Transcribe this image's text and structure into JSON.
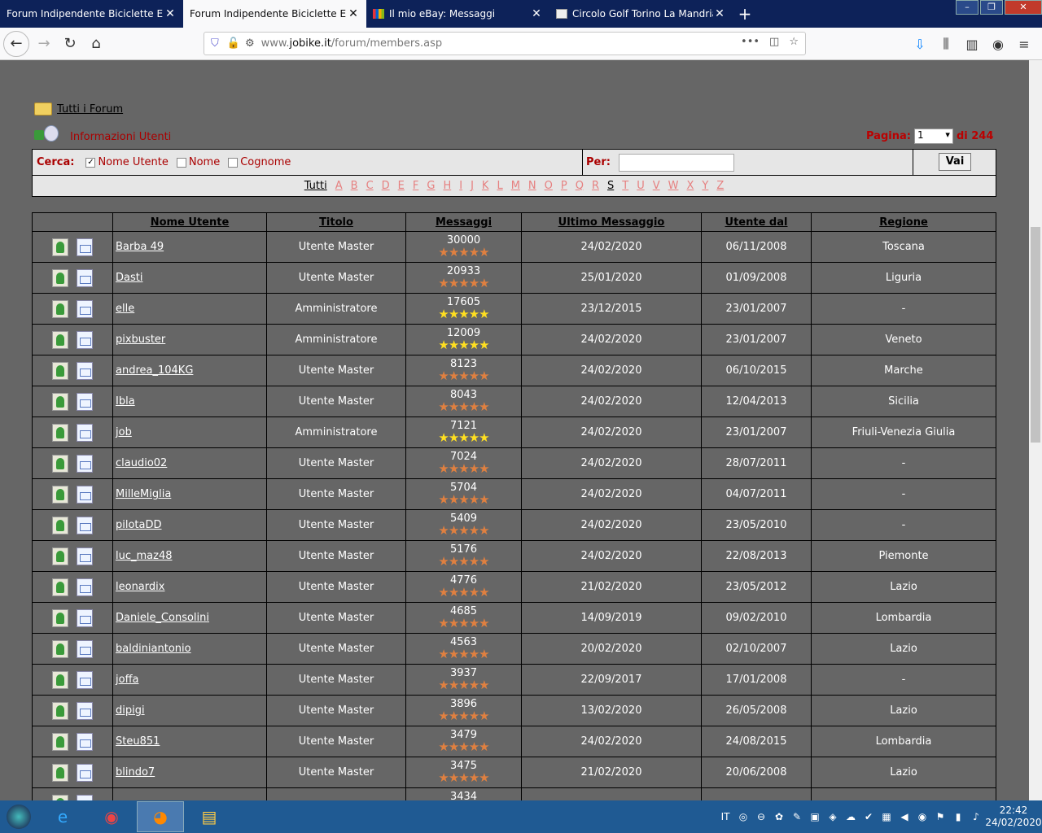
{
  "tabs": [
    {
      "label": "Forum Indipendente Biciclette Elett",
      "active": false
    },
    {
      "label": "Forum Indipendente Biciclette Elett",
      "active": true
    },
    {
      "label": "Il mio eBay: Messaggi",
      "active": false
    },
    {
      "label": "Circolo Golf Torino La Mandria",
      "active": false
    }
  ],
  "url": {
    "prefix": "www.",
    "domain": "jobike.it",
    "path": "/forum/members.asp"
  },
  "breadcrumb": {
    "all_forums": "Tutti i Forum",
    "members_info": "Informazioni Utenti"
  },
  "pagination": {
    "label": "Pagina:",
    "current": "1",
    "total": "di 244"
  },
  "search": {
    "cerca": "Cerca:",
    "opt_username": "Nome Utente",
    "opt_name": "Nome",
    "opt_surname": "Cognome",
    "per": "Per:",
    "button": "Vai"
  },
  "letters": [
    "Tutti",
    "A",
    "B",
    "C",
    "D",
    "E",
    "F",
    "G",
    "H",
    "I",
    "J",
    "K",
    "L",
    "M",
    "N",
    "O",
    "P",
    "Q",
    "R",
    "S",
    "T",
    "U",
    "V",
    "W",
    "X",
    "Y",
    "Z"
  ],
  "current_letter": "S",
  "columns": [
    "Nome Utente",
    "Titolo",
    "Messaggi",
    "Ultimo Messaggio",
    "Utente dal",
    "Regione"
  ],
  "members": [
    {
      "name": "Barba 49",
      "title": "Utente Master",
      "posts": "30000",
      "star": "o",
      "last": "24/02/2020",
      "since": "06/11/2008",
      "region": "Toscana"
    },
    {
      "name": "Dasti",
      "title": "Utente Master",
      "posts": "20933",
      "star": "o",
      "last": "25/01/2020",
      "since": "01/09/2008",
      "region": "Liguria"
    },
    {
      "name": "elle",
      "title": "Amministratore",
      "posts": "17605",
      "star": "y",
      "last": "23/12/2015",
      "since": "23/01/2007",
      "region": "-"
    },
    {
      "name": "pixbuster",
      "title": "Amministratore",
      "posts": "12009",
      "star": "y",
      "last": "24/02/2020",
      "since": "23/01/2007",
      "region": "Veneto"
    },
    {
      "name": "andrea_104KG",
      "title": "Utente Master",
      "posts": "8123",
      "star": "o",
      "last": "24/02/2020",
      "since": "06/10/2015",
      "region": "Marche"
    },
    {
      "name": "Ibla",
      "title": "Utente Master",
      "posts": "8043",
      "star": "o",
      "last": "24/02/2020",
      "since": "12/04/2013",
      "region": "Sicilia"
    },
    {
      "name": "job",
      "title": "Amministratore",
      "posts": "7121",
      "star": "y",
      "last": "24/02/2020",
      "since": "23/01/2007",
      "region": "Friuli-Venezia Giulia"
    },
    {
      "name": "claudio02",
      "title": "Utente Master",
      "posts": "7024",
      "star": "o",
      "last": "24/02/2020",
      "since": "28/07/2011",
      "region": "-"
    },
    {
      "name": "MilleMiglia",
      "title": "Utente Master",
      "posts": "5704",
      "star": "o",
      "last": "24/02/2020",
      "since": "04/07/2011",
      "region": "-"
    },
    {
      "name": "pilotaDD",
      "title": "Utente Master",
      "posts": "5409",
      "star": "o",
      "last": "24/02/2020",
      "since": "23/05/2010",
      "region": "-"
    },
    {
      "name": "luc_maz48",
      "title": "Utente Master",
      "posts": "5176",
      "star": "o",
      "last": "24/02/2020",
      "since": "22/08/2013",
      "region": "Piemonte"
    },
    {
      "name": "leonardix",
      "title": "Utente Master",
      "posts": "4776",
      "star": "o",
      "last": "21/02/2020",
      "since": "23/05/2012",
      "region": "Lazio"
    },
    {
      "name": "Daniele_Consolini",
      "title": "Utente Master",
      "posts": "4685",
      "star": "o",
      "last": "14/09/2019",
      "since": "09/02/2010",
      "region": "Lombardia"
    },
    {
      "name": "baldiniantonio",
      "title": "Utente Master",
      "posts": "4563",
      "star": "o",
      "last": "20/02/2020",
      "since": "02/10/2007",
      "region": "Lazio"
    },
    {
      "name": "joffa",
      "title": "Utente Master",
      "posts": "3937",
      "star": "o",
      "last": "22/09/2017",
      "since": "17/01/2008",
      "region": "-"
    },
    {
      "name": "dipigi",
      "title": "Utente Master",
      "posts": "3896",
      "star": "o",
      "last": "13/02/2020",
      "since": "26/05/2008",
      "region": "Lazio"
    },
    {
      "name": "Steu851",
      "title": "Utente Master",
      "posts": "3479",
      "star": "o",
      "last": "24/02/2020",
      "since": "24/08/2015",
      "region": "Lombardia"
    },
    {
      "name": "blindo7",
      "title": "Utente Master",
      "posts": "3475",
      "star": "o",
      "last": "21/02/2020",
      "since": "20/06/2008",
      "region": "Lazio"
    },
    {
      "name": "",
      "title": "",
      "posts": "3434",
      "star": "o",
      "last": "",
      "since": "",
      "region": ""
    }
  ],
  "stars_glyph": "★★★★★",
  "taskbar": {
    "lang": "IT",
    "time": "22:42",
    "date": "24/02/2020"
  }
}
